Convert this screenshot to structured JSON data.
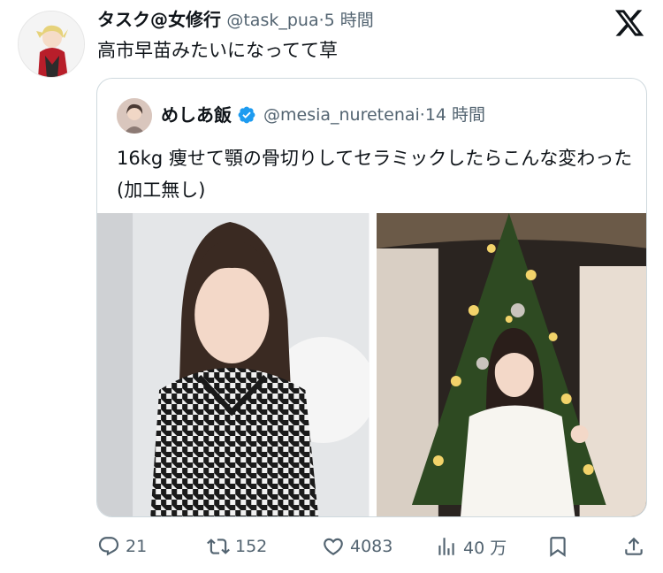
{
  "tweet": {
    "display_name": "タスク@女修行",
    "handle": "@task_pua",
    "separator": "·",
    "time": "5 時間",
    "text": "高市早苗みたいになってて草",
    "avatar_icon": "anime-character-avatar"
  },
  "quoted": {
    "display_name": "めしあ飯",
    "handle": "@mesia_nuretenai",
    "separator": "·",
    "time": "14 時間",
    "text": "16kg 痩せて顎の骨切りしてセラミックしたらこんな変わった (加工無し)",
    "verified_color": "#1d9bf0",
    "photos": [
      {
        "icon": "photo-before-houndstooth"
      },
      {
        "icon": "photo-after-christmas-tree"
      }
    ]
  },
  "actions": {
    "replies": "21",
    "retweets": "152",
    "likes": "4083",
    "views": "40 万"
  },
  "colors": {
    "secondary_text": "#536471",
    "border": "#cfd9de",
    "accent": "#1d9bf0"
  }
}
